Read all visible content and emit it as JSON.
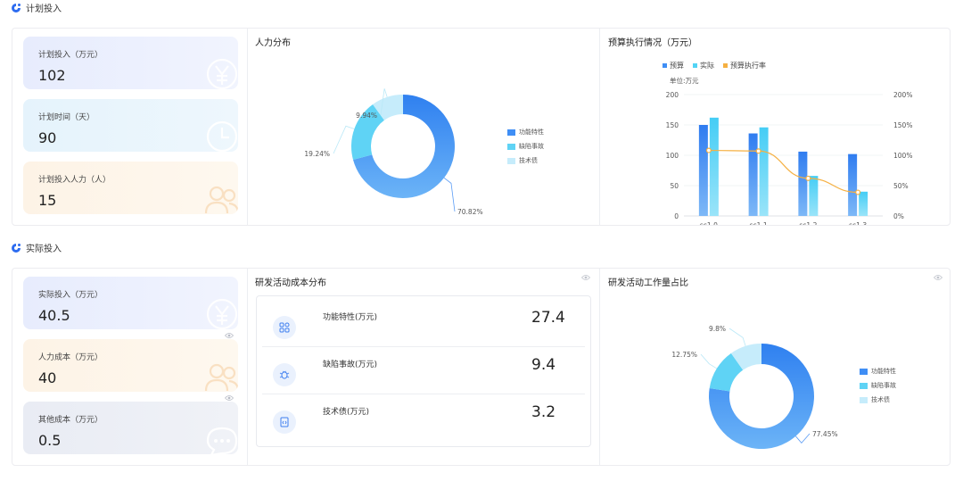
{
  "sections": {
    "planned": "计划投入",
    "actual": "实际投入"
  },
  "planned_cards": [
    {
      "label": "计划投入（万元）",
      "value": "102",
      "icon": "yen-icon",
      "color": "blue"
    },
    {
      "label": "计划时间（天）",
      "value": "90",
      "icon": "clock-icon",
      "color": "cyan"
    },
    {
      "label": "计划投入人力（人）",
      "value": "15",
      "icon": "people-icon",
      "color": "orange"
    }
  ],
  "actual_cards": [
    {
      "label": "实际投入（万元）",
      "value": "40.5",
      "icon": "yen-icon",
      "color": "blue"
    },
    {
      "label": "人力成本（万元）",
      "value": "40",
      "icon": "people-icon",
      "color": "orange"
    },
    {
      "label": "其他成本（万元）",
      "value": "0.5",
      "icon": "chat-icon",
      "color": "gray"
    }
  ],
  "colors": {
    "feature": "#3f8ef5",
    "defect": "#5fd3f5",
    "debt": "#c6ecfb",
    "budget": "#3f8ef5",
    "actual": "#52d4f5",
    "rate": "#f5b042"
  },
  "manpower": {
    "title": "人力分布",
    "legend": [
      "功能特性",
      "缺陷事故",
      "技术债"
    ]
  },
  "budget_chart": {
    "title": "预算执行情况（万元）",
    "legend": [
      "预算",
      "实际",
      "预算执行率"
    ],
    "unit": "单位:万元",
    "left_ticks": [
      "0",
      "50",
      "100",
      "150",
      "200"
    ],
    "right_ticks": [
      "0%",
      "50%",
      "100%",
      "150%",
      "200%"
    ]
  },
  "cost_dist": {
    "title": "研发活动成本分布",
    "items": [
      {
        "name": "功能特性(万元)",
        "value": "27.4",
        "icon": "feature-grid-icon"
      },
      {
        "name": "缺陷事故(万元)",
        "value": "9.4",
        "icon": "bug-icon"
      },
      {
        "name": "技术债(万元)",
        "value": "3.2",
        "icon": "code-file-icon"
      }
    ]
  },
  "workload": {
    "title": "研发活动工作量占比",
    "legend": [
      "功能特性",
      "缺陷事故",
      "技术债"
    ]
  },
  "chart_data": [
    {
      "type": "pie",
      "title": "人力分布",
      "categories": [
        "功能特性",
        "缺陷事故",
        "技术债"
      ],
      "values": [
        70.82,
        19.24,
        9.94
      ],
      "labels": [
        "70.82%",
        "19.24%",
        "9.94%"
      ],
      "legend_position": "right"
    },
    {
      "type": "bar",
      "title": "预算执行情况（万元）",
      "categories": [
        "sc1.0",
        "sc1.1",
        "sc1.2",
        "sc1.3"
      ],
      "series": [
        {
          "name": "预算",
          "values": [
            150,
            136,
            106,
            102
          ]
        },
        {
          "name": "实际",
          "values": [
            162,
            146,
            66,
            40
          ]
        },
        {
          "name": "预算执行率",
          "values": [
            108,
            107,
            62,
            39
          ],
          "kind": "line",
          "axis": "right"
        }
      ],
      "ylim": [
        0,
        200
      ],
      "y2lim": [
        0,
        200
      ],
      "legend_position": "top"
    },
    {
      "type": "pie",
      "title": "研发活动工作量占比",
      "categories": [
        "功能特性",
        "缺陷事故",
        "技术债"
      ],
      "values": [
        77.45,
        12.75,
        9.8
      ],
      "labels": [
        "77.45%",
        "12.75%",
        "9.8%"
      ],
      "legend_position": "right"
    }
  ]
}
